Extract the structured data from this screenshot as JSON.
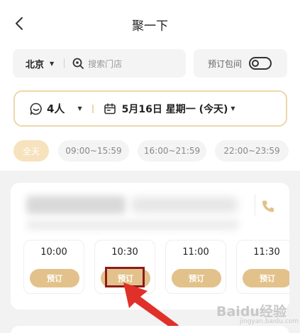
{
  "header": {
    "title": "聚一下"
  },
  "search": {
    "city": "北京",
    "placeholder": "搜索门店"
  },
  "package_toggle": {
    "label": "预订包间",
    "enabled": false
  },
  "selector": {
    "people": "4人",
    "date": "5月16日 星期一 (今天)"
  },
  "time_chips": [
    {
      "label": "全天",
      "active": true
    },
    {
      "label": "09:00~15:59",
      "active": false
    },
    {
      "label": "16:00~21:59",
      "active": false
    },
    {
      "label": "22:00~23:59",
      "active": false
    }
  ],
  "slots": [
    {
      "time": "10:00",
      "button": "预订"
    },
    {
      "time": "10:30",
      "button": "预订"
    },
    {
      "time": "11:00",
      "button": "预订"
    },
    {
      "time": "11:30",
      "button": "预订"
    }
  ],
  "watermark": {
    "text": "Baidu经验",
    "sub": "jingyan.baidu.com"
  },
  "colors": {
    "accent": "#e2c28a",
    "chip_active": "#f6e2bd",
    "highlight": "#8e1b1b",
    "arrow": "#e0302a"
  }
}
